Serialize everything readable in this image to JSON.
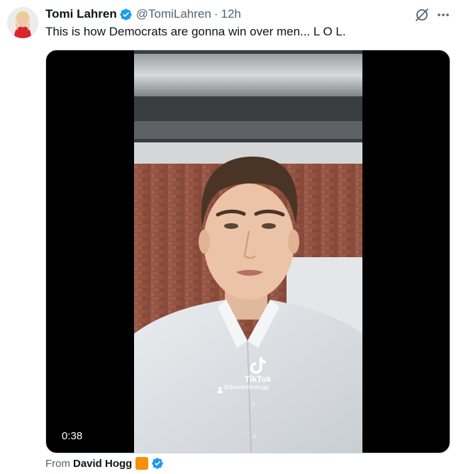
{
  "tweet": {
    "author_name": "Tomi Lahren",
    "handle": "@TomiLahren",
    "separator": "·",
    "time": "12h",
    "text": "This is how Democrats are gonna win over men... L O L."
  },
  "media": {
    "duration": "0:38",
    "watermark_brand": "TikTok",
    "watermark_user": "@davidmileshogg"
  },
  "attribution": {
    "prefix": "From",
    "name": "David Hogg"
  },
  "icons": [
    "verified-badge-icon",
    "grok-icon",
    "more-icon",
    "tiktok-logo-icon",
    "user-icon"
  ],
  "colors": {
    "verified_blue": "#1d9bf0",
    "secondary_text": "#536471",
    "primary_text": "#0f1419",
    "emoji_orange": "#f4900c"
  }
}
